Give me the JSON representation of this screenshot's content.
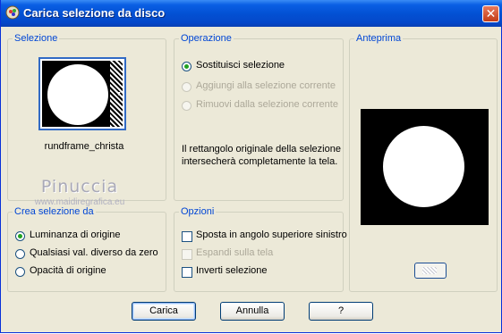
{
  "window": {
    "title": "Carica selezione da disco",
    "app_icon": "psp-app-icon",
    "close_icon": "close-icon"
  },
  "selezione": {
    "label": "Selezione",
    "filename": "rundframe_christa"
  },
  "watermark": {
    "title": "Pinuccia",
    "url": "www.maidiregrafica.eu"
  },
  "operazione": {
    "label": "Operazione",
    "options": [
      {
        "label": "Sostituisci selezione",
        "checked": true,
        "enabled": true
      },
      {
        "label": "Aggiungi alla selezione corrente",
        "checked": false,
        "enabled": false
      },
      {
        "label": "Rimuovi dalla selezione corrente",
        "checked": false,
        "enabled": false
      }
    ],
    "info": "Il rettangolo originale della selezione intersecherà completamente la tela."
  },
  "anteprima": {
    "label": "Anteprima",
    "zoom_icon": "preview-zoom-icon"
  },
  "crea": {
    "label": "Crea selezione da",
    "options": [
      {
        "label": "Luminanza di origine",
        "checked": true
      },
      {
        "label": "Qualsiasi val. diverso da zero",
        "checked": false
      },
      {
        "label": "Opacità di origine",
        "checked": false
      }
    ]
  },
  "opzioni": {
    "label": "Opzioni",
    "options": [
      {
        "label": "Sposta in angolo superiore sinistro",
        "checked": false,
        "enabled": true
      },
      {
        "label": "Espandi sulla tela",
        "checked": false,
        "enabled": false
      },
      {
        "label": "Inverti selezione",
        "checked": false,
        "enabled": true
      }
    ]
  },
  "buttons": {
    "load": "Carica",
    "cancel": "Annulla",
    "help": "?"
  }
}
